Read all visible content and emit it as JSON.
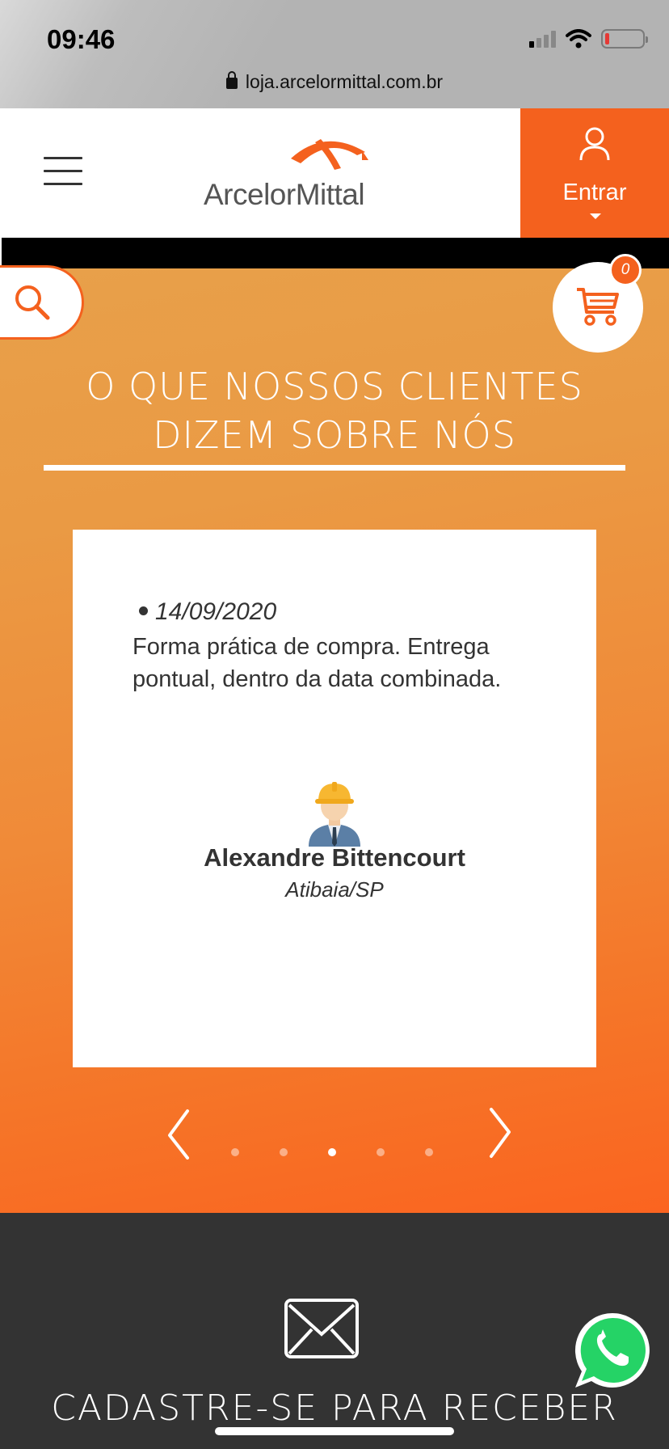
{
  "status_bar": {
    "time": "09:46",
    "url": "loja.arcelormittal.com.br"
  },
  "header": {
    "logo_text": "ArcelorMittal",
    "login_label": "Entrar"
  },
  "cart": {
    "count": "0"
  },
  "testimonials": {
    "title_line1": "O QUE NOSSOS CLIENTES",
    "title_line2": "DIZEM SOBRE NÓS",
    "review": {
      "date": "14/09/2020",
      "text": "Forma prática de compra. Entrega pontual, dentro da data combinada.",
      "author": "Alexandre Bittencourt",
      "location": "Atibaia/SP"
    },
    "pagination": {
      "total": 5,
      "active_index": 2
    }
  },
  "newsletter": {
    "title": "CADASTRE-SE PARA RECEBER"
  },
  "colors": {
    "brand_orange": "#f4611e",
    "dark_footer": "#333333",
    "whatsapp_green": "#25d366"
  }
}
